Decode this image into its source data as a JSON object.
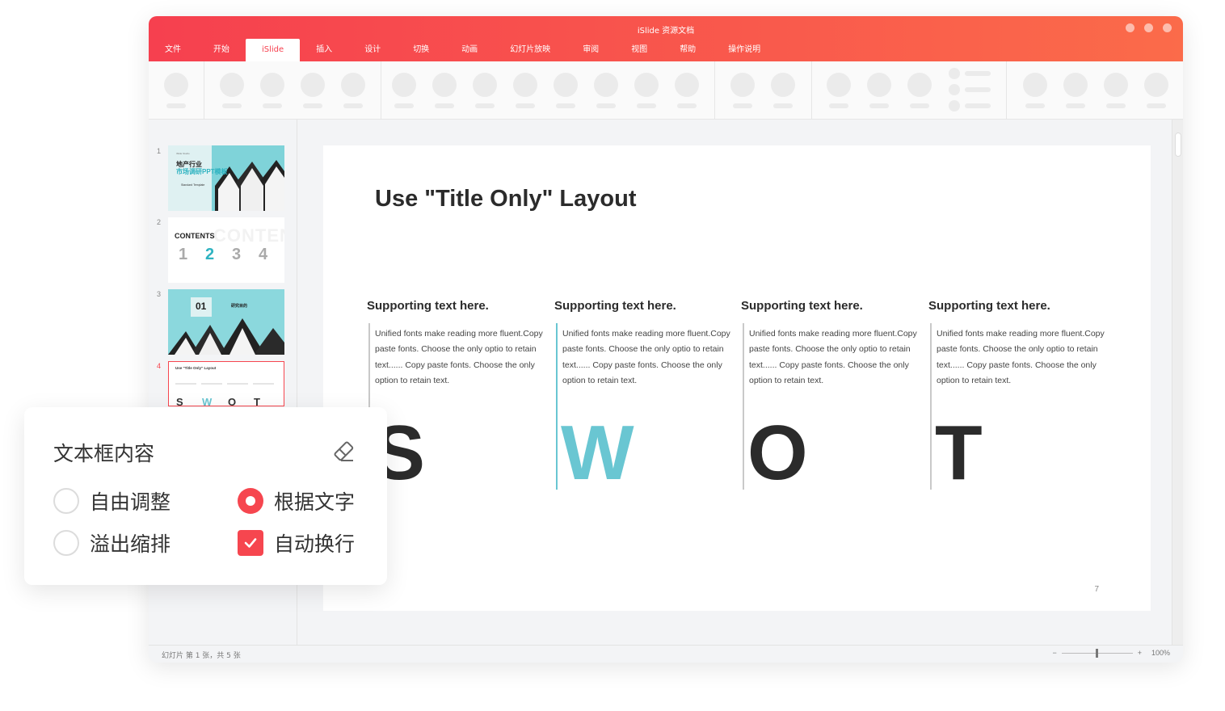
{
  "window": {
    "title": "iSlide 资源文档"
  },
  "menu": {
    "items": [
      {
        "label": "文件"
      },
      {
        "label": "开始"
      },
      {
        "label": "iSlide"
      },
      {
        "label": "插入"
      },
      {
        "label": "设计"
      },
      {
        "label": "切换"
      },
      {
        "label": "动画"
      },
      {
        "label": "幻灯片放映"
      },
      {
        "label": "审阅"
      },
      {
        "label": "视图"
      },
      {
        "label": "帮助"
      },
      {
        "label": "操作说明"
      }
    ],
    "active_index": 2
  },
  "thumbnails": [
    {
      "number": "1",
      "small_top": "iSlide Studio",
      "title_line1": "地产行业",
      "title_line2": "市场调研PPT模板",
      "subtitle": "Standard Template"
    },
    {
      "number": "2",
      "heading": "CONTENTS",
      "ghost": "CONTENTS",
      "digits": [
        "1",
        "2",
        "3",
        "4"
      ]
    },
    {
      "number": "3",
      "index": "01",
      "label": "研究目的"
    },
    {
      "number": "4",
      "title": "Use \"Title Only\" Layout",
      "letters": [
        "S",
        "W",
        "O",
        "T"
      ]
    }
  ],
  "slide": {
    "title": "Use \"Title Only\" Layout",
    "page_number": "7",
    "columns": [
      {
        "heading": "Supporting text here.",
        "body": "Unified  fonts make reading more fluent.Copy paste fonts. Choose the only optio to retain text...... Copy paste  fonts. Choose the only option to retain text.",
        "letter": "S"
      },
      {
        "heading": "Supporting text here.",
        "body": "Unified  fonts make reading more fluent.Copy paste fonts. Choose the only optio to retain text...... Copy paste  fonts. Choose the only option to retain text.",
        "letter": "W"
      },
      {
        "heading": "Supporting text here.",
        "body": "Unified  fonts make reading more fluent.Copy paste fonts. Choose the only optio to retain text...... Copy paste  fonts. Choose the only option to retain text.",
        "letter": "O"
      },
      {
        "heading": "Supporting text here.",
        "body": "Unified  fonts make reading more fluent.Copy paste fonts. Choose the only optio to retain text...... Copy paste  fonts. Choose the only option to retain text.",
        "letter": "T"
      }
    ]
  },
  "statusbar": {
    "slide_info": "幻灯片 第 1 张，共 5 张",
    "zoom_minus": "−",
    "zoom_plus": "+",
    "zoom_level": "100%"
  },
  "textbox_panel": {
    "title": "文本框内容",
    "options": {
      "free_resize": {
        "label": "自由调整",
        "selected": false
      },
      "fit_text": {
        "label": "根据文字",
        "selected": true
      },
      "overflow_shrink": {
        "label": "溢出缩排",
        "selected": false
      },
      "auto_wrap": {
        "label": "自动换行",
        "checked": true
      }
    }
  },
  "colors": {
    "brand_start": "#f6404f",
    "brand_end": "#fb6b4a",
    "accent_teal": "#69c6d2",
    "control_red": "#f6464f"
  },
  "icons": {
    "panel_reset": "eraser-icon",
    "check": "checkmark-icon"
  }
}
